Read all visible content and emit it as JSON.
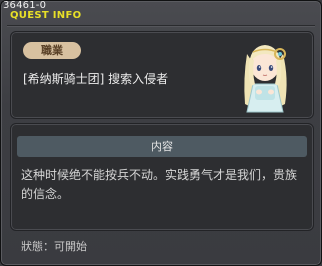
{
  "window": {
    "quest_id": "36461-0",
    "title": "QUEST INFO"
  },
  "quest": {
    "job_label": "職業",
    "name": "[希纳斯骑士团] 搜索入侵者",
    "avatar_icon": "npc-portrait-icon"
  },
  "content": {
    "header": "内容",
    "text": "这种时候绝不能按兵不动。实践勇气才是我们，贵族的信念。"
  },
  "status": {
    "text": "狀態：可開始"
  },
  "colors": {
    "title": "#e8e028",
    "badge": "#d8c1a0",
    "header_bar": "#4e5a62"
  }
}
